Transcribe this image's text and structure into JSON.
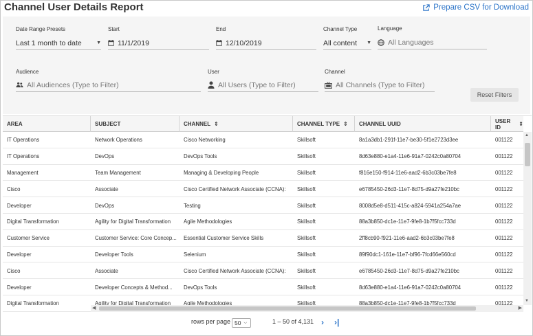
{
  "header": {
    "title": "Channel User Details Report",
    "csv_label": "Prepare CSV for Download"
  },
  "filters": {
    "date_range_presets": {
      "label": "Date Range Presets",
      "value": "Last 1 month to date"
    },
    "start": {
      "label": "Start",
      "value": "11/1/2019"
    },
    "end": {
      "label": "End",
      "value": "12/10/2019"
    },
    "channel_type": {
      "label": "Channel Type",
      "value": "All content"
    },
    "language": {
      "label": "Language",
      "placeholder": "All Languages"
    },
    "audience": {
      "label": "Audience",
      "placeholder": "All Audiences (Type to Filter)"
    },
    "user": {
      "label": "User",
      "placeholder": "All Users (Type to Filter)"
    },
    "channel": {
      "label": "Channel",
      "placeholder": "All Channels (Type to Filter)"
    },
    "reset_label": "Reset Filters"
  },
  "table": {
    "columns": [
      "AREA",
      "SUBJECT",
      "CHANNEL",
      "CHANNEL TYPE",
      "CHANNEL UUID",
      "USER ID"
    ],
    "rows": [
      [
        "IT Operations",
        "Network Operations",
        "Cisco Networking",
        "Skillsoft",
        "8a1a3db1-291f-11e7-be30-5f1e2723d3ee",
        "001122"
      ],
      [
        "IT Operations",
        "DevOps",
        "DevOps Tools",
        "Skillsoft",
        "8d63e880-e1a4-11e6-91a7-0242c0a80704",
        "001122"
      ],
      [
        "Management",
        "Team Management",
        "Managing & Developing People",
        "Skillsoft",
        "f816e150-f914-11e6-aad2-6b3c03be7fe8",
        "001122"
      ],
      [
        "Cisco",
        "Associate",
        "Cisco Certified Network Associate (CCNA):",
        "Skillsoft",
        "e6785450-26d3-11e7-8d75-d9a27fe210bc",
        "001122"
      ],
      [
        "Developer",
        "DevOps",
        "Testing",
        "Skillsoft",
        "8008d5e8-d511-415c-a824-5941a254a7ae",
        "001122"
      ],
      [
        "Digital Transformation",
        "Agility for Digital Transformation",
        "Agile Methodologies",
        "Skillsoft",
        "88a3b850-dc1e-11e7-9fe8-1b7f5fcc733d",
        "001122"
      ],
      [
        "Customer Service",
        "Customer Service: Core Concep...",
        "Essential Customer Service Skills",
        "Skillsoft",
        "2ff8cb90-f921-11e6-aad2-6b3c03be7fe8",
        "001122"
      ],
      [
        "Developer",
        "Developer Tools",
        "Selenium",
        "Skillsoft",
        "89f90dc1-161e-11e7-bf96-7fcd66e560cd",
        "001122"
      ],
      [
        "Cisco",
        "Associate",
        "Cisco Certified Network Associate (CCNA):",
        "Skillsoft",
        "e6785450-26d3-11e7-8d75-d9a27fe210bc",
        "001122"
      ],
      [
        "Developer",
        "Developer Concepts & Method...",
        "DevOps Tools",
        "Skillsoft",
        "8d63e880-e1a4-11e6-91a7-0242c0a80704",
        "001122"
      ],
      [
        "Digital Transformation",
        "Agility for Digital Transformation",
        "Agile Methodologies",
        "Skillsoft",
        "88a3b850-dc1e-11e7-9fe8-1b7f5fcc733d",
        "001122"
      ]
    ]
  },
  "pagination": {
    "rows_per_page_label": "rows per page",
    "rows_per_page_value": "50",
    "range_text": "1 – 50 of 4,131"
  }
}
